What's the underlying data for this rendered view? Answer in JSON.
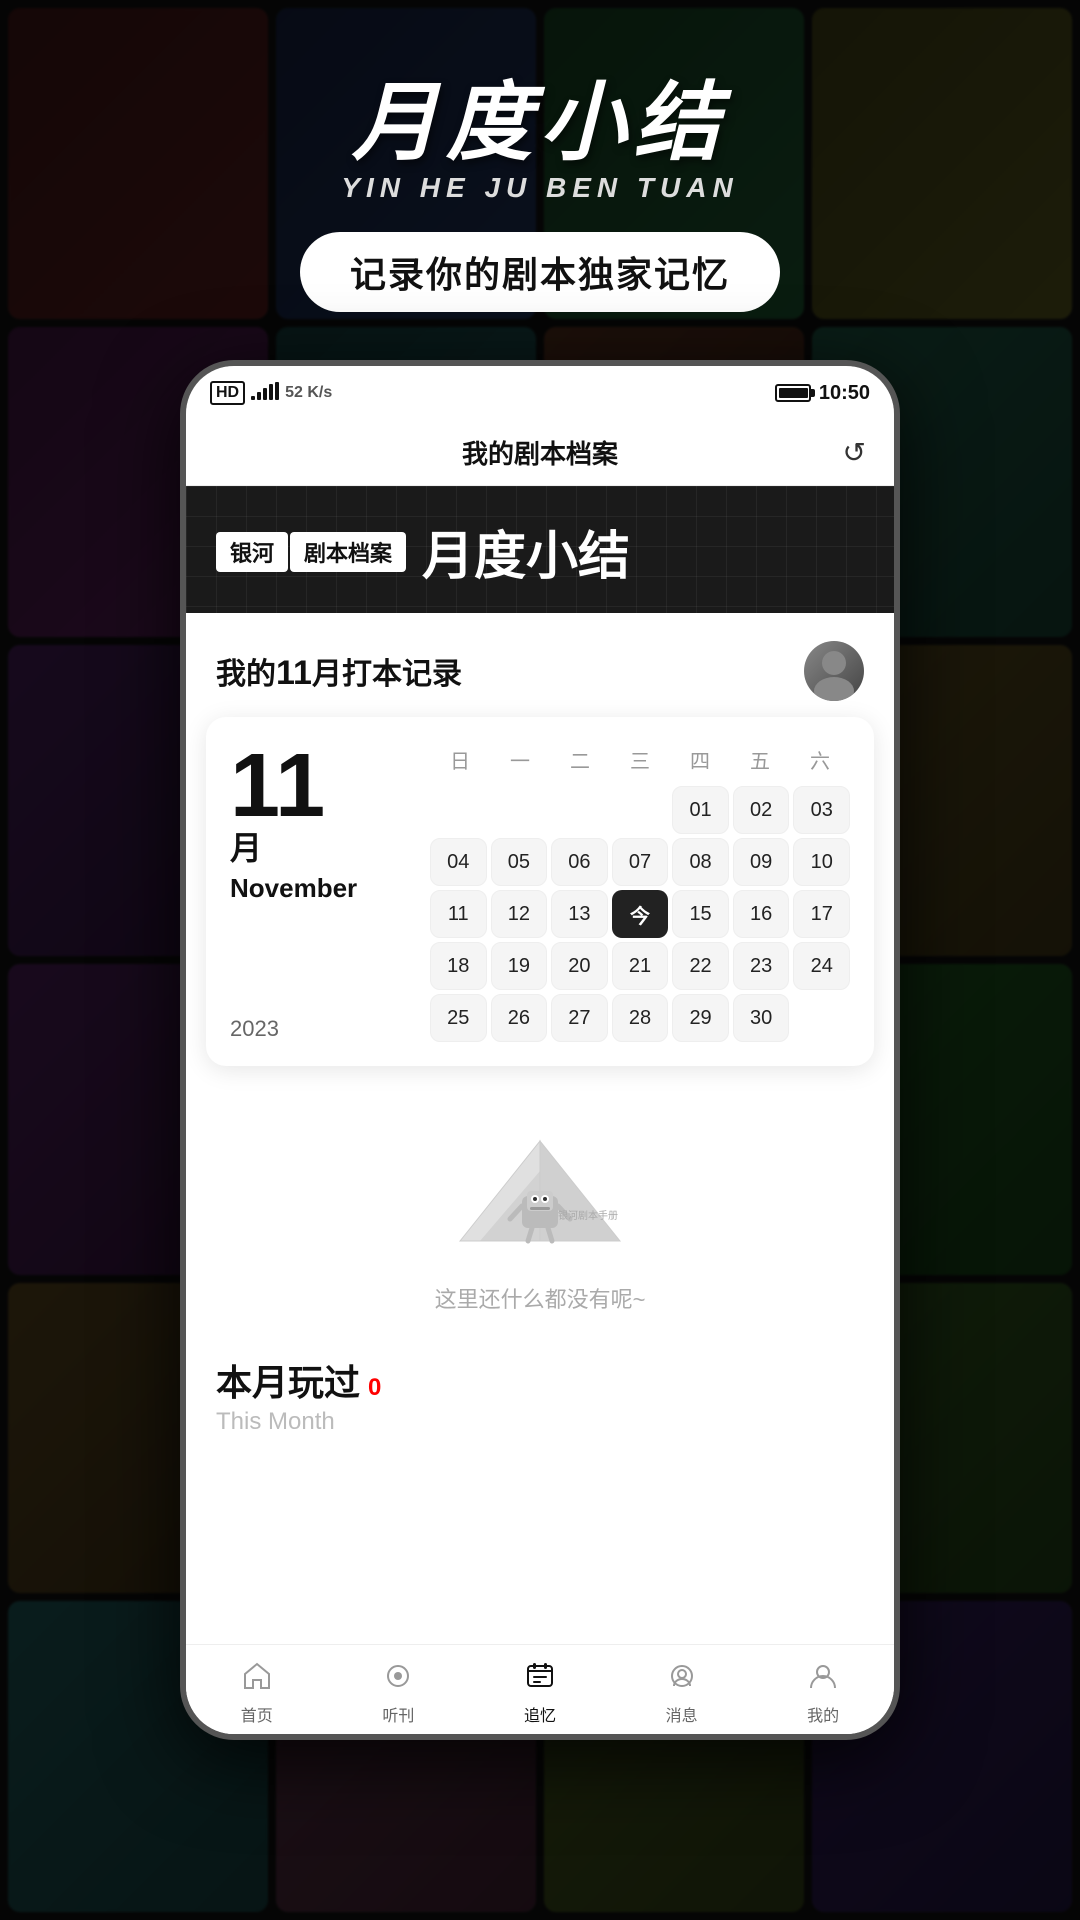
{
  "background": {
    "cards": 24
  },
  "header": {
    "main_title": "月度小结",
    "subtitle": "YIN HE JU BEN TUAN",
    "tagline": "记录你的剧本独家记忆"
  },
  "status_bar": {
    "signal": "4G",
    "network": "HD",
    "speed": "52 K/s",
    "battery": "95",
    "time": "10:50"
  },
  "phone_nav": {
    "title": "我的剧本档案",
    "back_icon": "↺"
  },
  "banner": {
    "tag1": "银河",
    "tag2": "剧本档案",
    "title": "月度小结"
  },
  "record": {
    "title_prefix": "我的",
    "month_num": "11",
    "title_suffix": "月打本记录"
  },
  "calendar": {
    "month_number": "11",
    "month_name": "November",
    "year": "2023",
    "weekdays": [
      "日",
      "一",
      "二",
      "三",
      "四",
      "五",
      "六"
    ],
    "days": [
      {
        "day": "",
        "type": "empty"
      },
      {
        "day": "",
        "type": "empty"
      },
      {
        "day": "",
        "type": "empty"
      },
      {
        "day": "",
        "type": "empty"
      },
      {
        "day": "01",
        "type": "box"
      },
      {
        "day": "02",
        "type": "box"
      },
      {
        "day": "03",
        "type": "box"
      },
      {
        "day": "04",
        "type": "box"
      },
      {
        "day": "05",
        "type": "box"
      },
      {
        "day": "06",
        "type": "box"
      },
      {
        "day": "07",
        "type": "box"
      },
      {
        "day": "08",
        "type": "box"
      },
      {
        "day": "09",
        "type": "box"
      },
      {
        "day": "10",
        "type": "box"
      },
      {
        "day": "11",
        "type": "box"
      },
      {
        "day": "12",
        "type": "box"
      },
      {
        "day": "13",
        "type": "box"
      },
      {
        "day": "今",
        "type": "today"
      },
      {
        "day": "15",
        "type": "box"
      },
      {
        "day": "16",
        "type": "box"
      },
      {
        "day": "17",
        "type": "box"
      },
      {
        "day": "18",
        "type": "box"
      },
      {
        "day": "19",
        "type": "box"
      },
      {
        "day": "20",
        "type": "box"
      },
      {
        "day": "21",
        "type": "box"
      },
      {
        "day": "22",
        "type": "box"
      },
      {
        "day": "23",
        "type": "box"
      },
      {
        "day": "24",
        "type": "box"
      },
      {
        "day": "25",
        "type": "box"
      },
      {
        "day": "26",
        "type": "box"
      },
      {
        "day": "27",
        "type": "box"
      },
      {
        "day": "28",
        "type": "box"
      },
      {
        "day": "29",
        "type": "box"
      },
      {
        "day": "30",
        "type": "box"
      }
    ]
  },
  "empty_state": {
    "text": "这里还什么都没有呢~"
  },
  "this_month": {
    "label_cn": "本月玩过",
    "badge": "0",
    "label_en": "This Month"
  },
  "bottom_nav": {
    "items": [
      {
        "label": "首页",
        "active": false
      },
      {
        "label": "听刊",
        "active": false
      },
      {
        "label": "追忆",
        "active": true
      },
      {
        "label": "消息",
        "active": false
      },
      {
        "label": "我的",
        "active": false
      }
    ]
  }
}
